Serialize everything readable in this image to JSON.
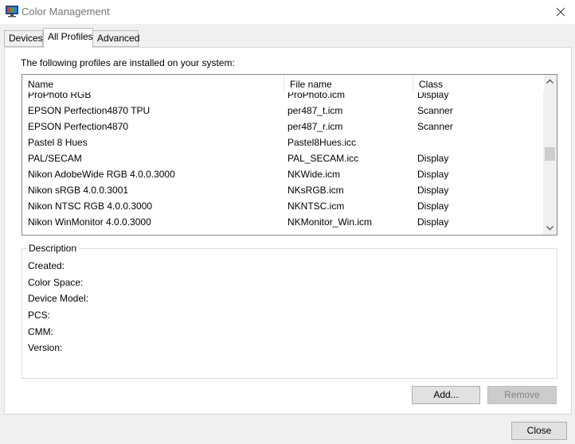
{
  "window": {
    "title": "Color Management"
  },
  "tabs": [
    {
      "label": "Devices",
      "active": false
    },
    {
      "label": "All Profiles",
      "active": true
    },
    {
      "label": "Advanced",
      "active": false
    }
  ],
  "profiles": {
    "intro": "The following profiles are installed on your system:",
    "columns": [
      "Name",
      "File name",
      "Class"
    ],
    "rows": [
      {
        "name": "ProPhoto RGB",
        "file": "ProPhoto.icm",
        "class": "Display"
      },
      {
        "name": "EPSON Perfection4870 TPU",
        "file": "per487_t.icm",
        "class": "Scanner"
      },
      {
        "name": "EPSON Perfection4870",
        "file": "per487_r.icm",
        "class": "Scanner"
      },
      {
        "name": "Pastel 8 Hues",
        "file": "Pastel8Hues.icc",
        "class": ""
      },
      {
        "name": "PAL/SECAM",
        "file": "PAL_SECAM.icc",
        "class": "Display"
      },
      {
        "name": "Nikon AdobeWide RGB 4.0.0.3000",
        "file": "NKWide.icm",
        "class": "Display"
      },
      {
        "name": "Nikon sRGB 4.0.0.3001",
        "file": "NKsRGB.icm",
        "class": "Display"
      },
      {
        "name": "Nikon NTSC RGB 4.0.0.3000",
        "file": "NKNTSC.icm",
        "class": "Display"
      },
      {
        "name": "Nikon WinMonitor 4.0.0.3000",
        "file": "NKMonitor_Win.icm",
        "class": "Display"
      }
    ]
  },
  "description": {
    "legend": "Description",
    "fields": {
      "created": "Created:",
      "color_space": "Color Space:",
      "device_model": "Device Model:",
      "pcs": "PCS:",
      "cmm": "CMM:",
      "version": "Version:"
    }
  },
  "buttons": {
    "add": "Add...",
    "remove": "Remove",
    "close": "Close"
  },
  "icons": {
    "app": "color-management-monitor-icon",
    "close": "close-icon",
    "scroll_up": "chevron-up-icon",
    "scroll_down": "chevron-down-icon"
  },
  "colors": {
    "list_border": "#828790",
    "button_face": "#e1e1e1",
    "button_disabled_text": "#838383"
  }
}
